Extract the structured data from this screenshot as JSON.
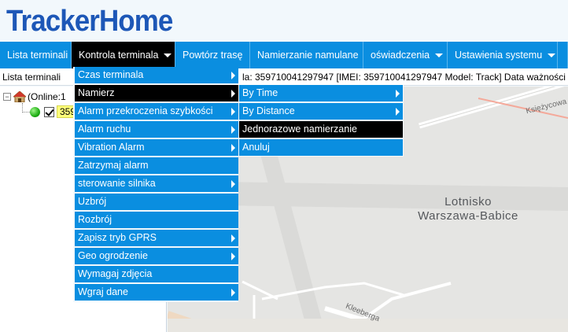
{
  "app": {
    "logo": "TrackerHome"
  },
  "nav": {
    "items": [
      {
        "label": "Lista terminali",
        "caret": false,
        "active": false
      },
      {
        "label": "Kontrola terminala",
        "caret": true,
        "active": true
      },
      {
        "label": "Powtórz trasę",
        "caret": false,
        "active": false
      },
      {
        "label": "Namierzanie namulane",
        "caret": false,
        "active": false
      },
      {
        "label": "oświadczenia",
        "caret": true,
        "active": false
      },
      {
        "label": "Ustawienia systemu",
        "caret": true,
        "active": false
      }
    ]
  },
  "info": {
    "left": "Lista terminali",
    "right": "la: 359710041297947 [IMEI: 359710041297947  Model: Track]  Data ważności"
  },
  "tree": {
    "root_label": "(Online:1",
    "expander": "−",
    "device_label": "359"
  },
  "menu": {
    "items": [
      {
        "label": "Czas terminala",
        "submenu": true
      },
      {
        "label": "Namierz",
        "submenu": true,
        "highlighted": true
      },
      {
        "label": "Alarm przekroczenia szybkości",
        "submenu": true
      },
      {
        "label": "Alarm ruchu",
        "submenu": true
      },
      {
        "label": "Vibration Alarm",
        "submenu": true
      },
      {
        "label": "Zatrzymaj alarm",
        "submenu": false
      },
      {
        "label": "sterowanie silnika",
        "submenu": true
      },
      {
        "label": "Uzbrój",
        "submenu": false
      },
      {
        "label": "Rozbrój",
        "submenu": false
      },
      {
        "label": "Zapisz tryb GPRS",
        "submenu": true
      },
      {
        "label": "Geo ogrodzenie",
        "submenu": true
      },
      {
        "label": "Wymagaj zdjęcia",
        "submenu": false
      },
      {
        "label": "Wgraj dane",
        "submenu": true
      }
    ],
    "submenu": [
      {
        "label": "By Time",
        "submenu": true
      },
      {
        "label": "By Distance",
        "submenu": true
      },
      {
        "label": "Jednorazowe namierzanie",
        "submenu": false,
        "highlighted": true
      },
      {
        "label": "Anuluj",
        "submenu": false
      }
    ]
  },
  "map": {
    "label_line1": "Lotnisko",
    "label_line2": "Warszawa-Babice",
    "street1": "Księżycowa",
    "street2": "Kleeberga"
  },
  "colors": {
    "accent": "#0a8ee0",
    "logo": "#1d57b7",
    "highlight": "#000000",
    "map_bg": "#e5e5e3",
    "runway": "#d6d6d4"
  }
}
